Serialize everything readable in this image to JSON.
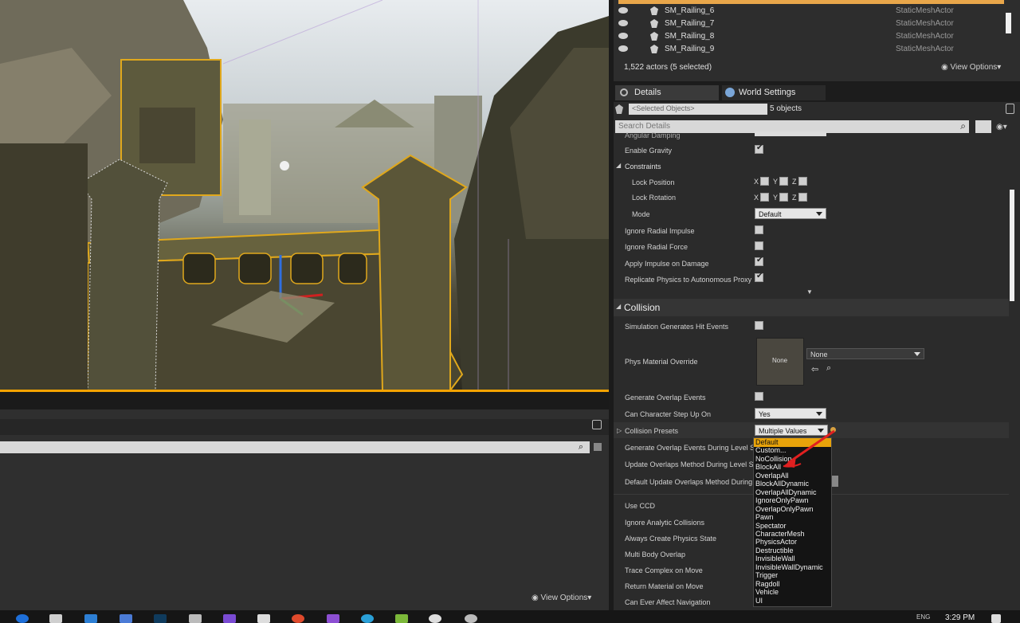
{
  "outliner": {
    "rows": [
      {
        "name": "SM_Railing_6",
        "type": "StaticMeshActor"
      },
      {
        "name": "SM_Railing_7",
        "type": "StaticMeshActor"
      },
      {
        "name": "SM_Railing_8",
        "type": "StaticMeshActor"
      },
      {
        "name": "SM_Railing_9",
        "type": "StaticMeshActor"
      }
    ],
    "actor_count": "1,522 actors (5 selected)",
    "view_options": "View Options"
  },
  "tabs": {
    "details": "Details",
    "world_settings": "World Settings"
  },
  "selection": {
    "placeholder": "<Selected Objects>",
    "count": "5 objects"
  },
  "search": {
    "placeholder": "Search Details"
  },
  "physics": {
    "angular_damping": "Angular Damping",
    "enable_gravity": "Enable Gravity",
    "constraints": "Constraints",
    "lock_position": "Lock Position",
    "lock_rotation": "Lock Rotation",
    "axis_x": "X",
    "axis_y": "Y",
    "axis_z": "Z",
    "mode": "Mode",
    "mode_value": "Default",
    "ignore_radial_impulse": "Ignore Radial Impulse",
    "ignore_radial_force": "Ignore Radial Force",
    "apply_impulse_on_damage": "Apply Impulse on Damage",
    "replicate_physics": "Replicate Physics to Autonomous Proxy"
  },
  "collision": {
    "header": "Collision",
    "sim_hit_events": "Simulation Generates Hit Events",
    "phys_material_override": "Phys Material Override",
    "phys_thumb": "None",
    "phys_combo": "None",
    "gen_overlap_events": "Generate Overlap Events",
    "can_step_up": "Can Character Step Up On",
    "can_step_up_value": "Yes",
    "collision_presets": "Collision Presets",
    "collision_presets_value": "Multiple Values",
    "gen_overlap_level": "Generate Overlap Events During Level S",
    "update_overlaps": "Update Overlaps Method During Level S",
    "default_update_overlaps": "Default Update Overlaps Method During",
    "use_ccd": "Use CCD",
    "ignore_analytic": "Ignore Analytic Collisions",
    "always_create_physics": "Always Create Physics State",
    "multi_body_overlap": "Multi Body Overlap",
    "trace_complex": "Trace Complex on Move",
    "return_material": "Return Material on Move",
    "affect_navigation": "Can Ever Affect Navigation"
  },
  "dropdown_options": [
    "Default",
    "Custom...",
    "NoCollision",
    "BlockAll",
    "OverlapAll",
    "BlockAllDynamic",
    "OverlapAllDynamic",
    "IgnoreOnlyPawn",
    "OverlapOnlyPawn",
    "Pawn",
    "Spectator",
    "CharacterMesh",
    "PhysicsActor",
    "Destructible",
    "InvisibleWall",
    "InvisibleWallDynamic",
    "Trigger",
    "Ragdoll",
    "Vehicle",
    "UI"
  ],
  "bottom_panel": {
    "view_options": "View Options"
  },
  "taskbar": {
    "time": "3:29 PM",
    "lang": "ENG"
  },
  "colors": {
    "accent": "#f4a300",
    "selection_outline": "#e0a81c",
    "arrow": "#e02020"
  }
}
